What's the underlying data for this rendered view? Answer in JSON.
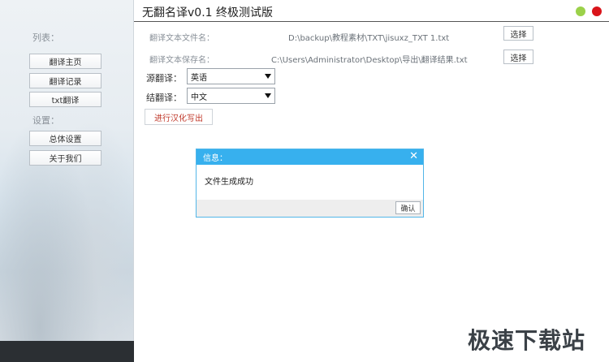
{
  "window": {
    "title": "无翻名译v0.1   终极测试版"
  },
  "sidebar": {
    "list_label": "列表：",
    "list_items": [
      {
        "label": "翻译主页"
      },
      {
        "label": "翻译记录"
      },
      {
        "label": "txt翻译"
      }
    ],
    "settings_label": "设置：",
    "settings_items": [
      {
        "label": "总体设置"
      },
      {
        "label": "关于我们"
      }
    ]
  },
  "form": {
    "source_file_label": "翻译文本文件名：",
    "source_file_path": "D:\\backup\\教程素材\\TXT\\jisuxz_TXT 1.txt",
    "save_file_label": "翻译文本保存名：",
    "save_file_path": "C:\\Users\\Administrator\\Desktop\\导出\\翻译结果.txt",
    "choose_label": "选择",
    "source_lang_label": "源翻译：",
    "source_lang_value": "英语",
    "target_lang_label": "结翻译：",
    "target_lang_value": "中文",
    "write_button_label": "进行汉化写出"
  },
  "dialog": {
    "title": "信息：",
    "close_glyph": "✕",
    "message": "文件生成成功",
    "ok_label": "确认"
  },
  "watermark": {
    "text": "极速下载站"
  },
  "colors": {
    "accent": "#37b0ee",
    "minimize": "#9bd14a",
    "close": "#d9141a",
    "warning_text": "#c0392b"
  }
}
